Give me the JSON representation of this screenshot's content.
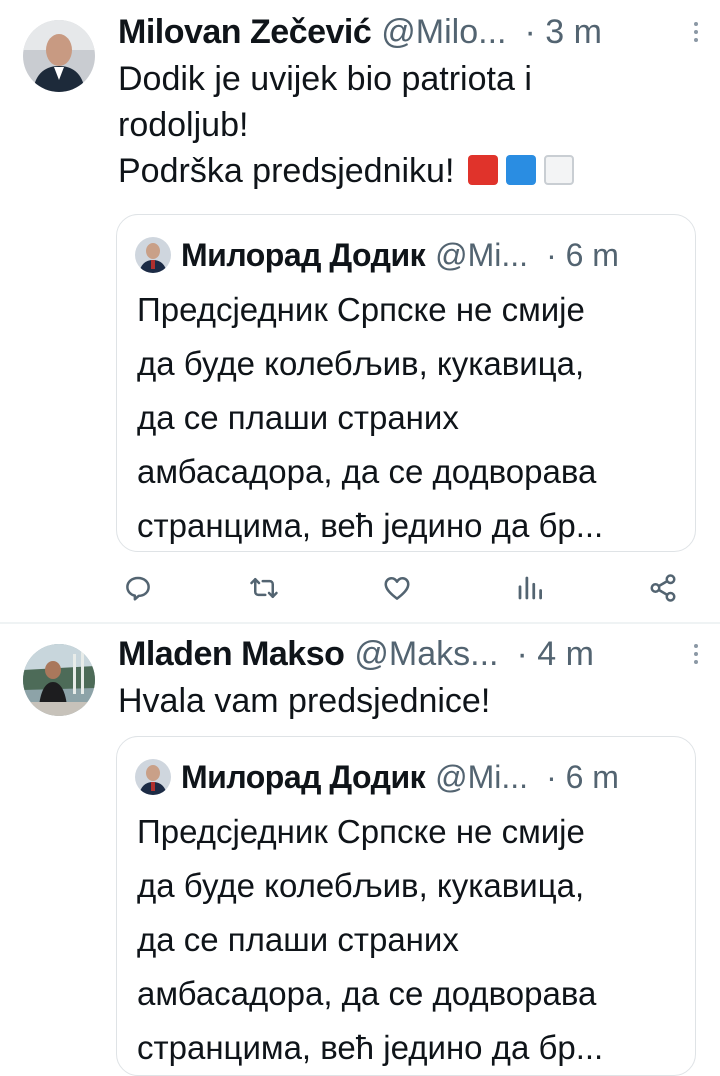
{
  "tweets": [
    {
      "author": "Milovan Zečević",
      "handle": "@Milo...",
      "separator": "·",
      "time": "3 m",
      "lines": [
        "Dodik je uvijek bio patriota i",
        "rodoljub!",
        "Podrška predsjedniku!"
      ],
      "flags": [
        "#e0332b",
        "#2a8de2",
        "#f3f4f5"
      ],
      "quote": {
        "author": "Милорад Додик",
        "handle": "@Mi...",
        "separator": "·",
        "time": "6 m",
        "lines": [
          "Предсједник Српске не смије",
          "да буде колебљив, кукавица,",
          "да се плаши страних",
          "амбасадора, да се додворава",
          "странцима, већ једино да бр..."
        ]
      },
      "actions": [
        "reply-icon",
        "retweet-icon",
        "like-icon",
        "views-icon",
        "share-icon"
      ]
    },
    {
      "author": "Mladen Makso",
      "handle": "@Maks...",
      "separator": "·",
      "time": "4 m",
      "lines": [
        "Hvala vam predsjednice!"
      ],
      "quote": {
        "author": "Милорад Додик",
        "handle": "@Mi...",
        "separator": "·",
        "time": "6 m",
        "lines": [
          "Предсједник Српске не смије",
          "да буде колебљив, кукавица,",
          "да се плаши страних",
          "амбасадора, да се додворава",
          "странцима, већ једино да бр..."
        ]
      }
    }
  ],
  "colors": {
    "text": "#0f1419",
    "secondary": "#536471",
    "border": "#dfe3e6",
    "icon": "#536471"
  }
}
